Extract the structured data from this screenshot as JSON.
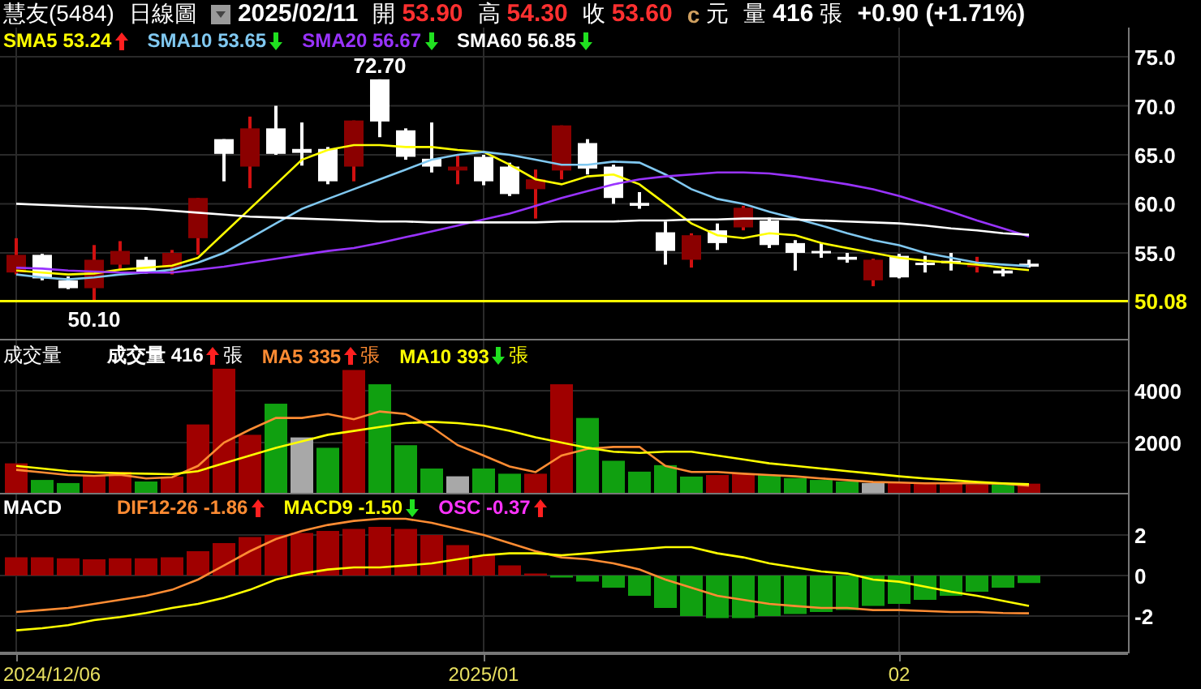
{
  "header": {
    "stock": "慧友(5484)",
    "period": "日線圖",
    "date": "2025/02/11",
    "fields": [
      {
        "label": "開",
        "value": "53.90"
      },
      {
        "label": "高",
        "value": "54.30"
      },
      {
        "label": "收",
        "value": "53.60"
      }
    ],
    "currency_mark": "c",
    "currency": "元",
    "volume": {
      "label": "量",
      "value": "416",
      "unit": "張"
    },
    "change": "+0.90 (+1.71%)"
  },
  "price_panel": {
    "legend": [
      {
        "label": "SMA5",
        "value": "53.24",
        "rising": true,
        "color": "#ffff00"
      },
      {
        "label": "SMA10",
        "value": "53.65",
        "rising": false,
        "color": "#80c8f0"
      },
      {
        "label": "SMA20",
        "value": "56.67",
        "rising": false,
        "color": "#9933ff"
      },
      {
        "label": "SMA60",
        "value": "56.85",
        "rising": false,
        "color": "#ffffff"
      }
    ],
    "chart_data": {
      "type": "candlestick",
      "grid": true,
      "ylim": [
        46.07,
        77.98
      ],
      "yticks": [
        {
          "value": 55,
          "label": "55.0"
        },
        {
          "value": 60,
          "label": "60.0"
        },
        {
          "value": 65,
          "label": "65.0"
        },
        {
          "value": 70,
          "label": "70.0"
        },
        {
          "value": 75,
          "label": "75.0"
        }
      ],
      "ohlc": [
        [
          53.0,
          56.5,
          52.8,
          54.8
        ],
        [
          54.8,
          54.9,
          52.2,
          52.4
        ],
        [
          52.2,
          52.6,
          51.3,
          51.4
        ],
        [
          51.4,
          55.8,
          50.1,
          54.3
        ],
        [
          53.8,
          56.2,
          53.3,
          55.2
        ],
        [
          54.3,
          54.6,
          52.9,
          53.0
        ],
        [
          53.5,
          55.3,
          52.8,
          55.0
        ],
        [
          56.5,
          60.6,
          54.8,
          60.6
        ],
        [
          66.6,
          66.6,
          62.3,
          65.1
        ],
        [
          63.8,
          68.9,
          61.6,
          67.7
        ],
        [
          67.7,
          70.0,
          65.0,
          65.1
        ],
        [
          65.6,
          68.3,
          63.9,
          65.2
        ],
        [
          65.6,
          65.8,
          62.0,
          62.3
        ],
        [
          63.8,
          68.5,
          62.3,
          68.5
        ],
        [
          72.7,
          72.7,
          66.8,
          68.4
        ],
        [
          67.5,
          67.7,
          64.5,
          64.8
        ],
        [
          64.6,
          68.3,
          63.2,
          63.8
        ],
        [
          63.4,
          65.0,
          62.0,
          63.8
        ],
        [
          64.8,
          65.0,
          61.9,
          62.3
        ],
        [
          63.8,
          64.2,
          60.8,
          61.0
        ],
        [
          61.5,
          63.5,
          58.5,
          62.5
        ],
        [
          63.4,
          68.0,
          62.5,
          68.0
        ],
        [
          66.2,
          66.6,
          63.0,
          63.6
        ],
        [
          63.8,
          64.0,
          60.0,
          60.6
        ],
        [
          60.1,
          61.2,
          59.5,
          59.8
        ],
        [
          57.1,
          58.2,
          53.8,
          55.2
        ],
        [
          54.3,
          57.0,
          53.5,
          56.8
        ],
        [
          57.3,
          58.0,
          55.3,
          56.0
        ],
        [
          57.6,
          59.8,
          57.3,
          59.6
        ],
        [
          58.3,
          58.6,
          55.5,
          55.8
        ],
        [
          56.0,
          56.3,
          53.2,
          55.0
        ],
        [
          55.2,
          56.0,
          54.5,
          55.0
        ],
        [
          54.6,
          55.0,
          54.0,
          54.3
        ],
        [
          52.2,
          54.4,
          51.6,
          54.3
        ],
        [
          54.7,
          54.9,
          52.4,
          52.5
        ],
        [
          54.0,
          54.7,
          53.0,
          53.8
        ],
        [
          54.2,
          55.0,
          53.2,
          54.0
        ],
        [
          53.6,
          54.6,
          53.0,
          53.8
        ],
        [
          53.2,
          53.4,
          52.6,
          52.9
        ],
        [
          53.9,
          54.3,
          53.5,
          53.6
        ]
      ],
      "series": [
        {
          "type": "line",
          "color": "#ffff00",
          "values": [
            53.2,
            53.0,
            52.8,
            52.9,
            53.3,
            53.5,
            53.7,
            54.5,
            57,
            59.5,
            62,
            64.5,
            65.5,
            66,
            66,
            65.8,
            65.8,
            65.5,
            65.3,
            64,
            62.5,
            62,
            62.8,
            63,
            62,
            60,
            58,
            56.8,
            56.5,
            57,
            56.8,
            56,
            55.5,
            55,
            54.5,
            54.2,
            54,
            53.8,
            53.5,
            53.24
          ]
        },
        {
          "type": "line",
          "color": "#80c8f0",
          "values": [
            52.8,
            52.5,
            52.3,
            52.5,
            52.8,
            53,
            53.3,
            54,
            55,
            56.5,
            58,
            59.5,
            60.5,
            61.5,
            62.5,
            63.5,
            64.5,
            65,
            65.3,
            65,
            64.5,
            64,
            64,
            64.3,
            64.2,
            63,
            61.5,
            60.5,
            60,
            59.2,
            58.5,
            57.8,
            57,
            56.3,
            55.8,
            55,
            54.5,
            54,
            53.8,
            53.65
          ]
        },
        {
          "type": "line",
          "color": "#9933ff",
          "values": [
            53.5,
            53.4,
            53.2,
            53.1,
            53,
            53,
            53,
            53.3,
            53.6,
            54,
            54.4,
            54.8,
            55.2,
            55.5,
            56,
            56.6,
            57.2,
            57.8,
            58.4,
            59,
            59.8,
            60.6,
            61.3,
            62,
            62.5,
            62.8,
            63,
            63.2,
            63.2,
            63.1,
            62.8,
            62.4,
            62,
            61.5,
            60.8,
            60,
            59.2,
            58.3,
            57.5,
            56.67
          ]
        },
        {
          "type": "line",
          "color": "#ffffff",
          "values": [
            60,
            59.9,
            59.8,
            59.7,
            59.6,
            59.5,
            59.3,
            59.1,
            58.9,
            58.7,
            58.6,
            58.5,
            58.4,
            58.3,
            58.2,
            58.2,
            58.1,
            58.1,
            58.1,
            58.1,
            58.1,
            58.2,
            58.2,
            58.2,
            58.3,
            58.3,
            58.4,
            58.4,
            58.5,
            58.5,
            58.4,
            58.3,
            58.2,
            58.1,
            58,
            57.8,
            57.5,
            57.3,
            57,
            56.85
          ]
        }
      ],
      "ref_lines": [
        {
          "axis": "y",
          "value": 50.08,
          "label": "50.08",
          "color": "#ffff00"
        }
      ],
      "annotations": [
        {
          "text": "72.70",
          "y": 72.7
        },
        {
          "text": "50.10",
          "y": 50.1
        }
      ]
    }
  },
  "volume_panel": {
    "title": "成交量",
    "legend": [
      {
        "label": "成交量",
        "value": "416",
        "rising": true,
        "unit": "張",
        "color": "#ffffff"
      },
      {
        "label": "MA5",
        "value": "335",
        "rising": true,
        "unit": "張",
        "color": "#ff8c33"
      },
      {
        "label": "MA10",
        "value": "393",
        "rising": false,
        "unit": "張",
        "color": "#ffff00"
      }
    ],
    "chart_data": {
      "type": "bar",
      "grid": true,
      "ylim": [
        0,
        5940
      ],
      "yticks": [
        2000,
        4000
      ],
      "series": [
        {
          "type": "bar",
          "color": "#a00000",
          "values": [
            1200,
            null,
            null,
            750,
            870,
            null,
            690,
            2700,
            4850,
            2300,
            null,
            null,
            null,
            4800,
            null,
            null,
            null,
            null,
            null,
            null,
            800,
            4250,
            null,
            null,
            null,
            null,
            null,
            750,
            800,
            null,
            null,
            null,
            null,
            null,
            440,
            440,
            440,
            380,
            null,
            416
          ]
        },
        {
          "type": "bar",
          "color": "#10a010",
          "values": [
            null,
            560,
            440,
            null,
            null,
            500,
            null,
            null,
            null,
            null,
            3500,
            null,
            1800,
            null,
            4250,
            1900,
            1000,
            null,
            1000,
            800,
            null,
            null,
            2950,
            1300,
            880,
            1130,
            690,
            null,
            null,
            750,
            630,
            560,
            500,
            null,
            null,
            null,
            null,
            null,
            440,
            null
          ]
        },
        {
          "type": "bar",
          "color": "#a8a8a8",
          "values": [
            null,
            null,
            null,
            null,
            null,
            null,
            null,
            null,
            null,
            null,
            null,
            2200,
            null,
            null,
            null,
            null,
            null,
            700,
            null,
            null,
            null,
            null,
            null,
            null,
            null,
            null,
            null,
            null,
            null,
            null,
            null,
            null,
            null,
            440,
            null,
            null,
            null,
            null,
            null,
            null
          ]
        },
        {
          "type": "line",
          "color": "#ff8c33",
          "values": [
            950,
            850,
            750,
            720,
            760,
            620,
            660,
            1100,
            2000,
            2500,
            2950,
            2950,
            3100,
            2900,
            3200,
            3100,
            2600,
            1900,
            1500,
            1080,
            860,
            1500,
            1760,
            1830,
            1840,
            1100,
            870,
            870,
            800,
            750,
            700,
            620,
            550,
            480,
            460,
            430,
            430,
            430,
            420,
            335
          ]
        },
        {
          "type": "line",
          "color": "#ffff00",
          "values": [
            1100,
            1000,
            900,
            850,
            820,
            800,
            780,
            900,
            1200,
            1500,
            1800,
            2050,
            2300,
            2450,
            2600,
            2750,
            2800,
            2750,
            2650,
            2450,
            2200,
            2000,
            1800,
            1650,
            1600,
            1650,
            1650,
            1500,
            1350,
            1200,
            1100,
            1000,
            900,
            800,
            700,
            620,
            550,
            480,
            430,
            393
          ]
        }
      ]
    }
  },
  "macd_panel": {
    "title": "MACD",
    "legend": [
      {
        "label": "DIF12-26",
        "value": "-1.86",
        "rising": true,
        "color": "#ff8c33"
      },
      {
        "label": "MACD9",
        "value": "-1.50",
        "rising": false,
        "color": "#ffff00"
      },
      {
        "label": "OSC",
        "value": "-0.37",
        "rising": true,
        "color": "#ff33ff"
      }
    ],
    "chart_data": {
      "type": "bar",
      "grid": true,
      "ylim": [
        -3.84,
        4
      ],
      "yticks": [
        -2,
        0,
        2
      ],
      "series": [
        {
          "type": "bar",
          "colors": [
            "#a00000",
            "#a00000",
            "#a00000",
            "#a00000",
            "#a00000",
            "#a00000",
            "#a00000",
            "#a00000",
            "#a00000",
            "#a00000",
            "#a00000",
            "#a00000",
            "#a00000",
            "#a00000",
            "#a00000",
            "#a00000",
            "#a00000",
            "#a00000",
            "#a00000",
            "#a00000",
            "#a00000",
            "#10a010",
            "#10a010",
            "#10a010",
            "#10a010",
            "#10a010",
            "#10a010",
            "#10a010",
            "#10a010",
            "#10a010",
            "#10a010",
            "#10a010",
            "#10a010",
            "#10a010",
            "#10a010",
            "#10a010",
            "#10a010",
            "#10a010",
            "#10a010",
            "#10a010"
          ],
          "values": [
            0.9,
            0.9,
            0.85,
            0.8,
            0.85,
            0.85,
            0.9,
            1.2,
            1.6,
            1.9,
            2.0,
            2.1,
            2.2,
            2.3,
            2.4,
            2.3,
            2.0,
            1.5,
            1.0,
            0.5,
            0.1,
            -0.1,
            -0.3,
            -0.6,
            -1.0,
            -1.6,
            -2.0,
            -2.1,
            -2.1,
            -2.0,
            -1.9,
            -1.8,
            -1.7,
            -1.5,
            -1.4,
            -1.2,
            -1.0,
            -0.8,
            -0.6,
            -0.37
          ]
        },
        {
          "type": "line",
          "color": "#ff8c33",
          "values": [
            -1.8,
            -1.7,
            -1.6,
            -1.4,
            -1.2,
            -1.0,
            -0.7,
            -0.2,
            0.5,
            1.2,
            1.8,
            2.2,
            2.5,
            2.7,
            2.8,
            2.8,
            2.6,
            2.3,
            2.0,
            1.6,
            1.2,
            0.9,
            0.8,
            0.6,
            0.3,
            -0.2,
            -0.6,
            -1.0,
            -1.2,
            -1.4,
            -1.5,
            -1.6,
            -1.6,
            -1.7,
            -1.7,
            -1.75,
            -1.8,
            -1.8,
            -1.85,
            -1.86
          ]
        },
        {
          "type": "line",
          "color": "#ffff00",
          "values": [
            -2.7,
            -2.6,
            -2.45,
            -2.2,
            -2.05,
            -1.85,
            -1.6,
            -1.4,
            -1.1,
            -0.7,
            -0.2,
            0.1,
            0.3,
            0.4,
            0.4,
            0.5,
            0.6,
            0.8,
            1.0,
            1.1,
            1.1,
            1.0,
            1.1,
            1.2,
            1.3,
            1.4,
            1.4,
            1.1,
            0.9,
            0.6,
            0.4,
            0.2,
            0.1,
            -0.2,
            -0.3,
            -0.55,
            -0.8,
            -1.0,
            -1.25,
            -1.5
          ]
        }
      ]
    }
  },
  "date_axis": {
    "labels": [
      "2024/12/06",
      "2025/01",
      "02"
    ]
  }
}
